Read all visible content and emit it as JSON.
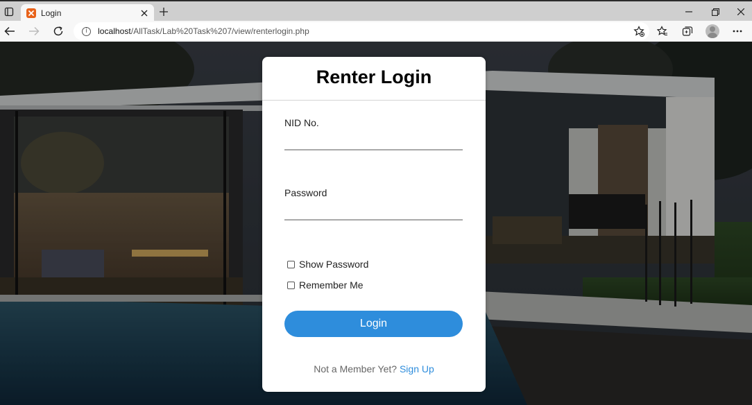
{
  "browser": {
    "tab_title": "Login",
    "url_host": "localhost",
    "url_path": "/AllTask/Lab%20Task%207/view/renterlogin.php",
    "favicon_color": "#e8621a"
  },
  "icons": {
    "tab_actions": "tab-actions-icon",
    "favicon": "xampp-icon",
    "tab_close": "close-icon",
    "new_tab": "plus-icon",
    "minimize": "minimize-icon",
    "restore": "restore-icon",
    "window_close": "close-icon",
    "back": "back-arrow-icon",
    "forward": "forward-arrow-icon",
    "refresh": "refresh-icon",
    "info": "info-icon",
    "add_favorite": "add-favorite-icon",
    "favorites": "favorites-icon",
    "collections": "collections-icon",
    "profile": "profile-icon",
    "more": "more-icon"
  },
  "login": {
    "title": "Renter Login",
    "nid_label": "NID No.",
    "nid_value": "",
    "password_label": "Password",
    "password_value": "",
    "show_password_label": "Show Password",
    "show_password_checked": false,
    "remember_me_label": "Remember Me",
    "remember_me_checked": false,
    "login_button": "Login",
    "signup_prompt": "Not a Member Yet?",
    "signup_link": "Sign Up"
  },
  "colors": {
    "accent": "#2e8ddc",
    "card_bg": "#ffffff",
    "backdrop": "#1d2228"
  }
}
